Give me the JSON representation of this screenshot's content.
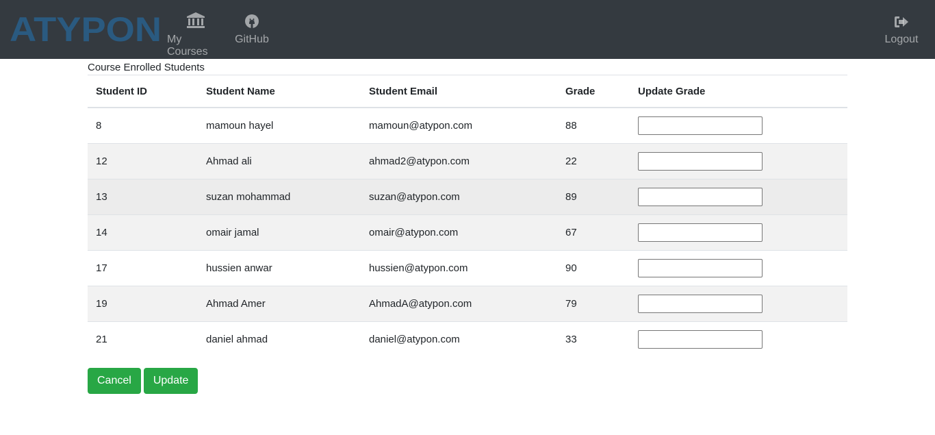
{
  "navbar": {
    "brand": "ATYPON",
    "brand_color": "#2a5a80",
    "background": "#343a40",
    "items": [
      {
        "label": "My Courses",
        "icon": "bank-icon"
      },
      {
        "label": "GitHub",
        "icon": "github-icon"
      },
      {
        "label": "Logout",
        "icon": "sign-out-icon"
      }
    ]
  },
  "table": {
    "caption": "Course Enrolled Students",
    "headers": [
      "Student ID",
      "Student Name",
      "Student Email",
      "Grade",
      "Update Grade"
    ],
    "rows": [
      {
        "id": "8",
        "name": "mamoun hayel",
        "email": "mamoun@atypon.com",
        "grade": "88",
        "new_grade": ""
      },
      {
        "id": "12",
        "name": "Ahmad ali",
        "email": "ahmad2@atypon.com",
        "grade": "22",
        "new_grade": ""
      },
      {
        "id": "13",
        "name": "suzan mohammad",
        "email": "suzan@atypon.com",
        "grade": "89",
        "new_grade": ""
      },
      {
        "id": "14",
        "name": "omair jamal",
        "email": "omair@atypon.com",
        "grade": "67",
        "new_grade": ""
      },
      {
        "id": "17",
        "name": "hussien anwar",
        "email": "hussien@atypon.com",
        "grade": "90",
        "new_grade": ""
      },
      {
        "id": "19",
        "name": "Ahmad Amer",
        "email": "AhmadA@atypon.com",
        "grade": "79",
        "new_grade": ""
      },
      {
        "id": "21",
        "name": "daniel ahmad",
        "email": "daniel@atypon.com",
        "grade": "33",
        "new_grade": ""
      }
    ]
  },
  "actions": {
    "cancel_label": "Cancel",
    "update_label": "Update",
    "button_color": "#28a745"
  }
}
